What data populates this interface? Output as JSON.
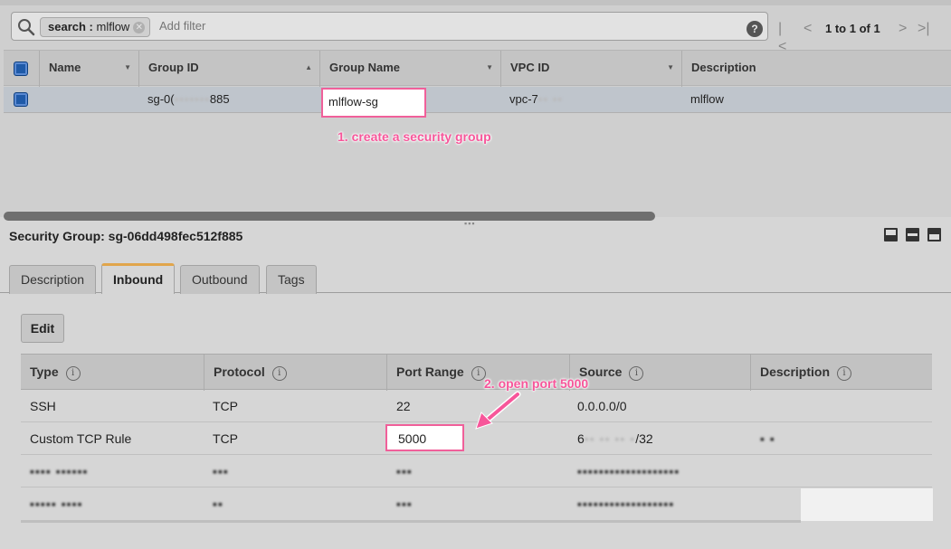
{
  "filter": {
    "chip_key": "search",
    "chip_sep": " : ",
    "chip_value": "mlflow",
    "add_filter_placeholder": "Add filter",
    "help_glyph": "?"
  },
  "pager": {
    "first": "|<",
    "prev": "<",
    "text": "1 to 1 of 1",
    "next": ">",
    "last": ">|"
  },
  "grid": {
    "columns": [
      "Name",
      "Group ID",
      "Group Name",
      "VPC ID",
      "Description"
    ],
    "row": {
      "name": "",
      "group_id_prefix": "sg-0(",
      "group_id_hidden": "▪▪▪▪▪▪▪",
      "group_id_suffix": "885",
      "group_name": "mlflow-sg",
      "vpc_id_prefix": "vpc-7",
      "vpc_id_hidden": "▪▪ ▪▪",
      "description": "mlflow"
    }
  },
  "annotations": {
    "step1": "1. create a security group",
    "step2": "2. open port 5000"
  },
  "details": {
    "title": "Security Group: sg-06dd498fec512f885",
    "tabs": [
      "Description",
      "Inbound",
      "Outbound",
      "Tags"
    ],
    "active_tab": "Inbound",
    "edit_label": "Edit",
    "info_glyph": "i",
    "rule_columns": [
      "Type",
      "Protocol",
      "Port Range",
      "Source",
      "Description"
    ],
    "rules": [
      {
        "type": "SSH",
        "protocol": "TCP",
        "port": "22",
        "source": "0.0.0.0/0",
        "description": ""
      },
      {
        "type": "Custom TCP Rule",
        "protocol": "TCP",
        "port": "5000",
        "source_prefix": "6",
        "source_hidden": "▪▪ ▪▪ ▪▪ ▪",
        "source_suffix": "/32",
        "description": "▪ ▪"
      },
      {
        "type": "▪▪▪▪ ▪▪▪▪▪▪",
        "protocol": "▪▪▪",
        "port": "▪▪▪",
        "source": "▪▪▪▪▪▪▪▪▪▪▪▪▪▪▪▪▪▪▪",
        "description": ""
      },
      {
        "type": "▪▪▪▪▪ ▪▪▪▪",
        "protocol": "▪▪",
        "port": "▪▪▪",
        "source": "▪▪▪▪▪▪▪▪▪▪▪▪▪▪▪▪▪▪",
        "description": ""
      }
    ]
  },
  "colors": {
    "annotation": "#f7569a",
    "selected_row": "#bfc5cc",
    "checkbox": "#1f5aa8",
    "active_tab_accent": "#e1a54b"
  }
}
